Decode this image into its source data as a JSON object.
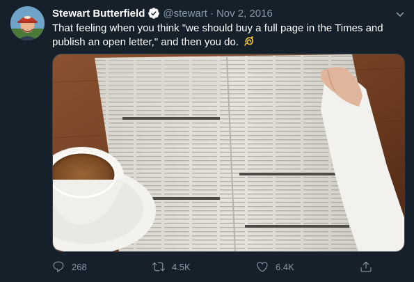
{
  "tweet": {
    "author_name": "Stewart Butterfield",
    "handle": "@stewart",
    "separator": "·",
    "date": "Nov 2, 2016",
    "text": "That feeling when you think \"we should buy a full page in the Times and publish an open letter,\" and then you do.",
    "emoji": "dizzy-emoji"
  },
  "actions": {
    "reply_count": "268",
    "retweet_count": "4.5K",
    "like_count": "6.4K"
  },
  "icons": {
    "verified": "verified-badge-icon",
    "caret": "chevron-down-icon",
    "reply": "reply-icon",
    "retweet": "retweet-icon",
    "like": "heart-icon",
    "share": "share-icon"
  },
  "colors": {
    "background": "#15202b",
    "secondary_text": "#8899a6",
    "verified": "#1da1f2"
  }
}
